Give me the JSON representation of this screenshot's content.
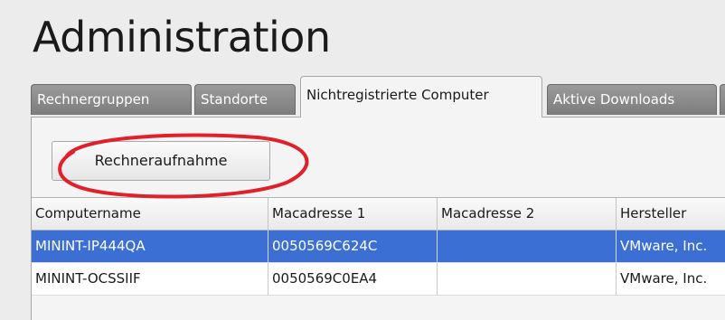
{
  "page": {
    "title": "Administration"
  },
  "tabs": [
    {
      "label": "Rechnergruppen",
      "active": false
    },
    {
      "label": "Standorte",
      "active": false
    },
    {
      "label": "Nichtregistrierte Computer",
      "active": true
    },
    {
      "label": "Aktive Downloads",
      "active": false
    }
  ],
  "toolbar": {
    "capture_button_label": "Rechneraufnahme"
  },
  "table": {
    "columns": [
      "Computername",
      "Macadresse 1",
      "Macadresse 2",
      "Hersteller"
    ],
    "rows": [
      {
        "computername": "MININT-IP444QA",
        "mac1": "0050569C624C",
        "mac2": "",
        "hersteller": "VMware, Inc.",
        "selected": true
      },
      {
        "computername": "MININT-OCSSIIF",
        "mac1": "0050569C0EA4",
        "mac2": "",
        "hersteller": "VMware, Inc.",
        "selected": false
      }
    ]
  },
  "colors": {
    "selection": "#3c6fd4",
    "inactive_tab": "#8a8a8a",
    "highlight_ellipse": "#e0202a"
  }
}
